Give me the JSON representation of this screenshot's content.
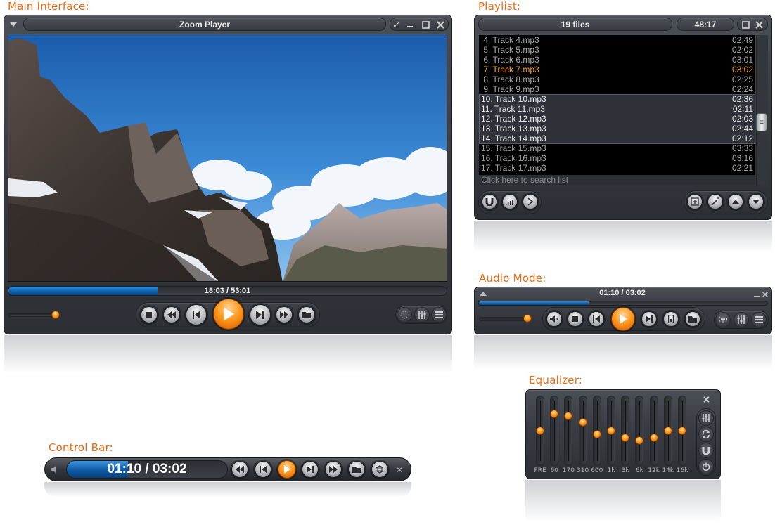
{
  "labels": {
    "main": "Main Interface:",
    "playlist": "Playlist:",
    "audio": "Audio Mode:",
    "equalizer": "Equalizer:",
    "controlbar": "Control Bar:"
  },
  "main": {
    "title": "Zoom Player",
    "menu_icon": "triangle-down",
    "window_buttons": [
      "fullscreen",
      "minimize",
      "maximize",
      "close"
    ],
    "time": "18:03 / 53:01",
    "progress": 0.34,
    "volume": 0.38,
    "transport": [
      "stop",
      "rewind",
      "previous",
      "play",
      "next",
      "fast-forward",
      "open"
    ],
    "right_buttons": [
      "visualization",
      "equalizer",
      "playlist"
    ]
  },
  "playlist": {
    "file_count": "19 files",
    "total_time": "48:17",
    "window_buttons": [
      "maximize",
      "close"
    ],
    "items": [
      {
        "name": " 4. Track 4.mp3",
        "time": "02:49",
        "state": ""
      },
      {
        "name": " 5. Track 5.mp3",
        "time": "02:02",
        "state": ""
      },
      {
        "name": " 6. Track 6.mp3",
        "time": "03:01",
        "state": ""
      },
      {
        "name": " 7. Track 7.mp3",
        "time": "03:02",
        "state": "playing"
      },
      {
        "name": " 8. Track 8.mp3",
        "time": "02:25",
        "state": ""
      },
      {
        "name": " 9. Track 9.mp3",
        "time": "02:24",
        "state": ""
      },
      {
        "name": "10. Track 10.mp3",
        "time": "02:36",
        "state": "selected"
      },
      {
        "name": "11. Track 11.mp3",
        "time": "02:11",
        "state": "selected"
      },
      {
        "name": "12. Track 12.mp3",
        "time": "02:03",
        "state": "selected"
      },
      {
        "name": "13. Track 13.mp3",
        "time": "02:44",
        "state": "selected"
      },
      {
        "name": "14. Track 14.mp3",
        "time": "02:12",
        "state": "selected"
      },
      {
        "name": "15. Track 15.mp3",
        "time": "03:33",
        "state": ""
      },
      {
        "name": "16. Track 16.mp3",
        "time": "03:16",
        "state": ""
      },
      {
        "name": "17. Track 17.mp3",
        "time": "02:21",
        "state": ""
      }
    ],
    "search_placeholder": "Click here to search list",
    "left_buttons": [
      "magnet",
      "signal-bars",
      "chevron-right"
    ],
    "right_buttons": [
      "add",
      "magic-wand",
      "move-up",
      "move-down"
    ]
  },
  "audio": {
    "time": "01:10 / 03:02",
    "progress": 0.38,
    "volume": 0.92,
    "transport": [
      "audio-track",
      "stop",
      "previous",
      "play",
      "next",
      "device",
      "open"
    ],
    "right_buttons": [
      "broadcast",
      "equalizer",
      "playlist"
    ]
  },
  "equalizer": {
    "bands": [
      {
        "label": "PRE",
        "level": 0.5
      },
      {
        "label": "60",
        "level": 0.78
      },
      {
        "label": "170",
        "level": 0.74
      },
      {
        "label": "310",
        "level": 0.64
      },
      {
        "label": "600",
        "level": 0.44
      },
      {
        "label": "1k",
        "level": 0.5
      },
      {
        "label": "3k",
        "level": 0.38
      },
      {
        "label": "6k",
        "level": 0.34
      },
      {
        "label": "12k",
        "level": 0.38
      },
      {
        "label": "14k",
        "level": 0.5
      },
      {
        "label": "16k",
        "level": 0.5
      }
    ],
    "side_buttons": [
      "close",
      "equalizer",
      "repeat",
      "magnet",
      "power"
    ]
  },
  "controlbar": {
    "time": "01:10 / 03:02",
    "progress": 0.38,
    "transport": [
      "rewind",
      "previous",
      "play",
      "next",
      "fast-forward",
      "open",
      "fullscreen"
    ],
    "close": "×"
  }
}
